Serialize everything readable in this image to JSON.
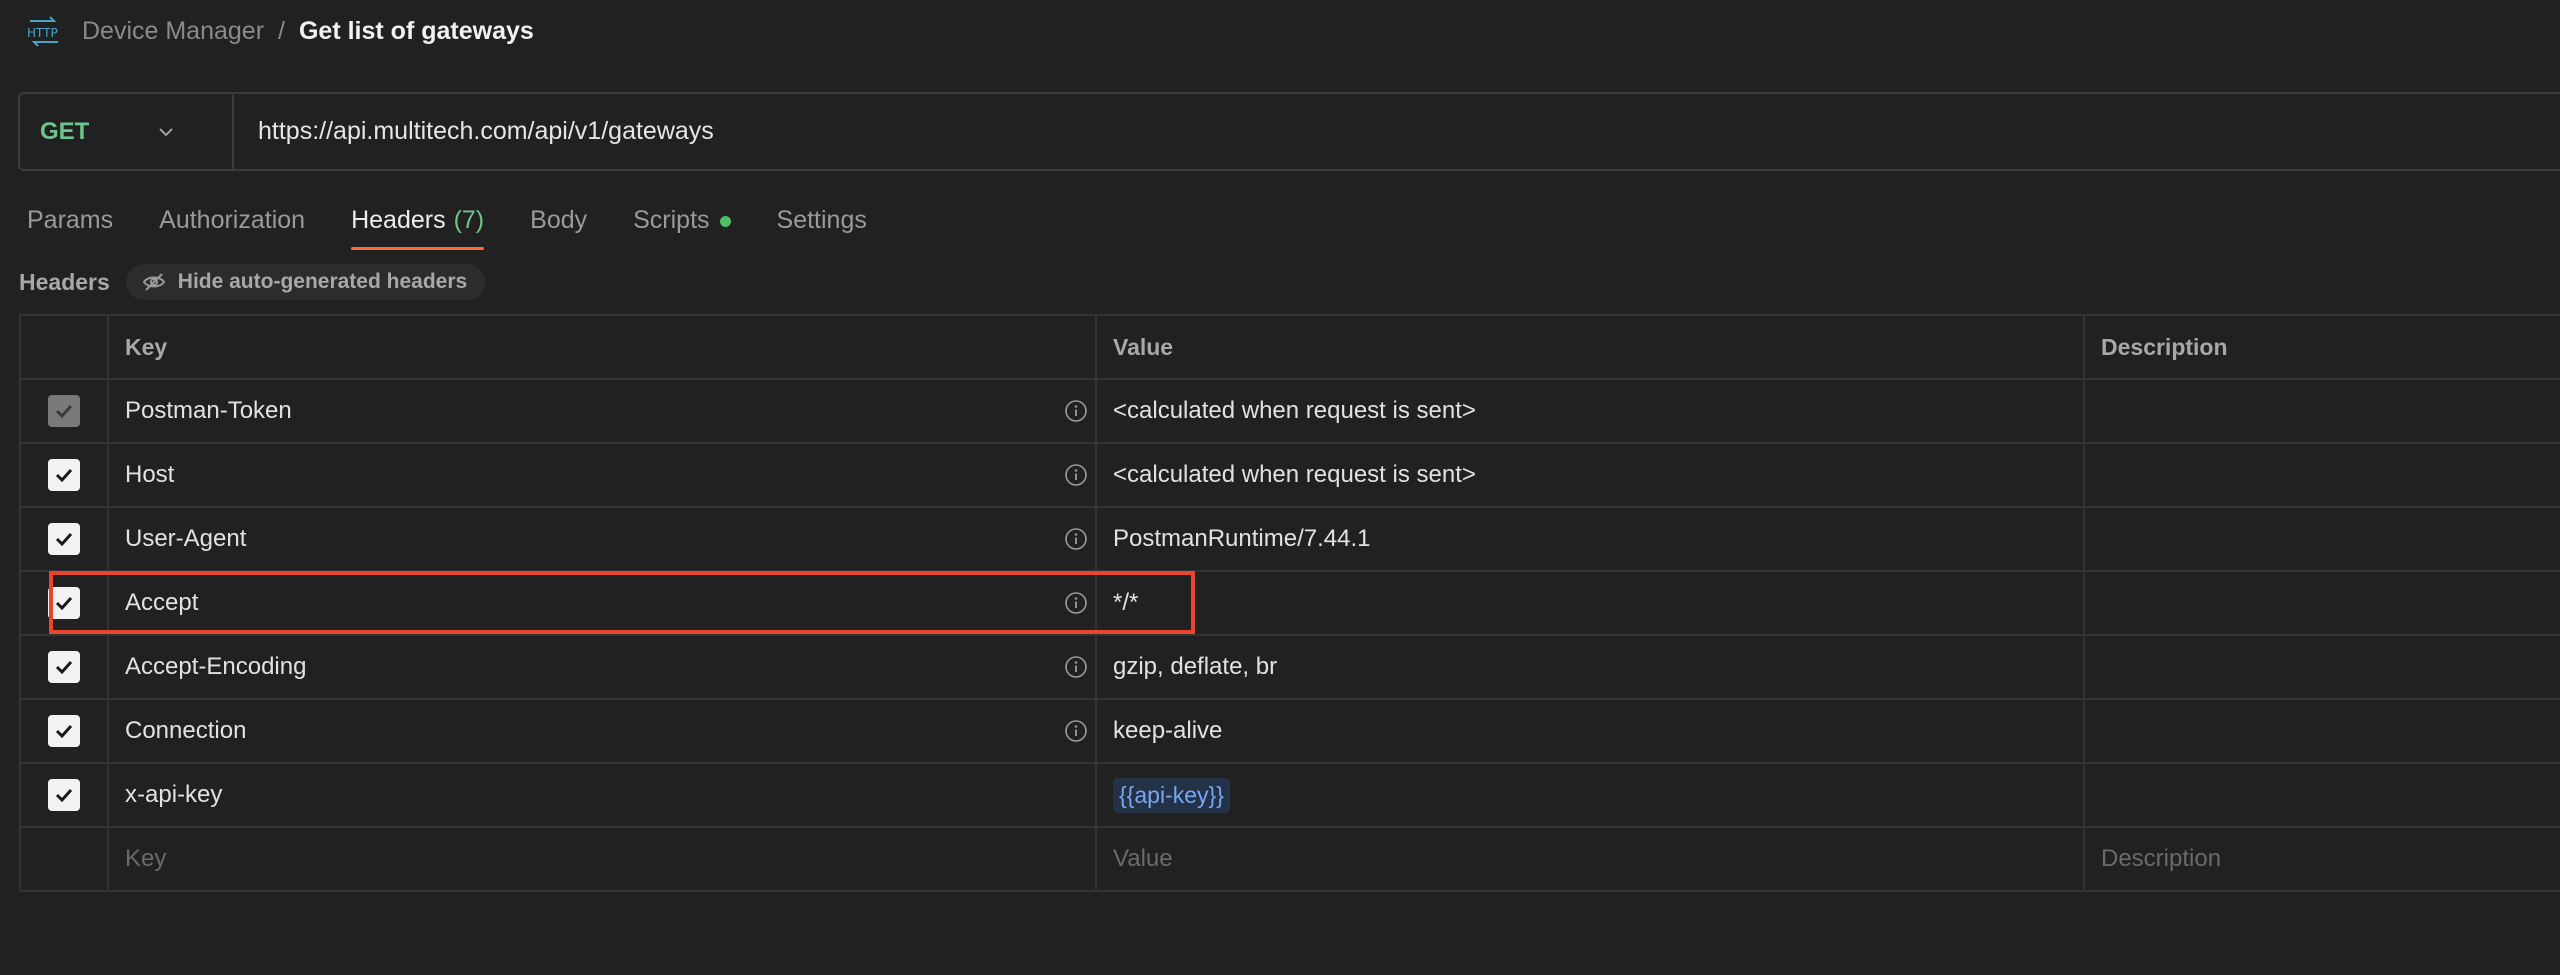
{
  "breadcrumb": {
    "icon": "http-icon",
    "icon_text": "HTTP",
    "parent": "Device Manager",
    "separator": "/",
    "current": "Get list of gateways"
  },
  "request": {
    "method": "GET",
    "url": "https://api.multitech.com/api/v1/gateways"
  },
  "tabs": [
    {
      "label": "Params"
    },
    {
      "label": "Authorization"
    },
    {
      "label": "Headers",
      "count": "(7)",
      "active": true
    },
    {
      "label": "Body"
    },
    {
      "label": "Scripts",
      "dot": true
    },
    {
      "label": "Settings"
    }
  ],
  "headers_section": {
    "title": "Headers",
    "hide_button": "Hide auto-generated headers"
  },
  "table": {
    "columns": [
      "Key",
      "Value",
      "Description"
    ],
    "rows": [
      {
        "key": "Postman-Token",
        "value": "<calculated when request is sent>",
        "checked": true,
        "disabled": true
      },
      {
        "key": "Host",
        "value": "<calculated when request is sent>",
        "checked": true
      },
      {
        "key": "User-Agent",
        "value": "PostmanRuntime/7.44.1",
        "checked": true
      },
      {
        "key": "Accept",
        "value": "*/*",
        "checked": true
      },
      {
        "key": "Accept-Encoding",
        "value": "gzip, deflate, br",
        "checked": true
      },
      {
        "key": "Connection",
        "value": "keep-alive",
        "checked": true
      },
      {
        "key": "x-api-key",
        "value": "{{api-key}}",
        "checked": true
      }
    ],
    "placeholder": {
      "key": "Key",
      "value": "Value",
      "description": "Description"
    }
  },
  "colors": {
    "accent": "#ff6c37",
    "method_get": "#6cc48d",
    "highlight": "#e8452c",
    "variable": "#78a6f0"
  }
}
